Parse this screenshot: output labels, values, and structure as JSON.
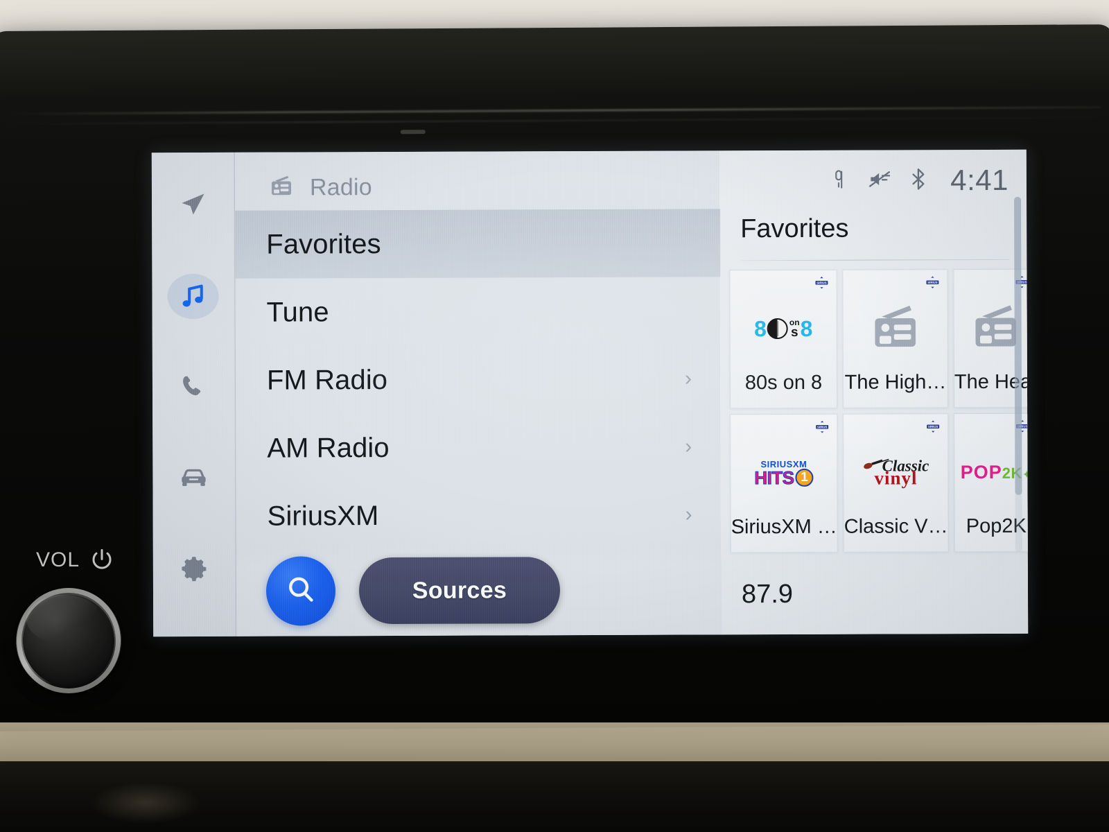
{
  "hardware": {
    "vol_label": "VOL",
    "power_icon": "power-icon",
    "knob_name": "volume-knob"
  },
  "statusbar": {
    "icons": [
      "mic-mute-icon",
      "sound-mute-icon",
      "bluetooth-icon"
    ],
    "time": "4:41"
  },
  "sidebar": {
    "items": [
      {
        "icon": "navigation-arrow-icon",
        "name": "navigation",
        "active": false
      },
      {
        "icon": "music-note-icon",
        "name": "audio",
        "active": true
      },
      {
        "icon": "phone-icon",
        "name": "phone",
        "active": false
      },
      {
        "icon": "car-icon",
        "name": "vehicle",
        "active": false
      },
      {
        "icon": "gear-icon",
        "name": "settings",
        "active": false
      }
    ]
  },
  "list_panel": {
    "header": {
      "icon": "radio-icon",
      "label": "Radio"
    },
    "menu": [
      {
        "label": "Favorites",
        "selected": true,
        "chevron": ""
      },
      {
        "label": "Tune",
        "selected": false,
        "chevron": ""
      },
      {
        "label": "FM Radio",
        "selected": false,
        "chevron": "›"
      },
      {
        "label": "AM Radio",
        "selected": false,
        "chevron": "›"
      },
      {
        "label": "SiriusXM",
        "selected": false,
        "chevron": "›"
      }
    ],
    "search_icon": "search-icon",
    "sources_label": "Sources"
  },
  "favorites": {
    "title": "Favorites",
    "tiles": [
      {
        "label": "80s on 8",
        "logo": "80s-on-8-logo",
        "badge": "siriusxm-badge"
      },
      {
        "label": "The High…",
        "logo": "generic-radio-icon",
        "badge": "siriusxm-badge"
      },
      {
        "label": "The Heat",
        "logo": "generic-radio-icon",
        "badge": "siriusxm-badge"
      },
      {
        "label": "SiriusXM …",
        "logo": "siriusxm-hits1-logo",
        "badge": "siriusxm-badge"
      },
      {
        "label": "Classic V…",
        "logo": "classic-vinyl-logo",
        "badge": "siriusxm-badge"
      },
      {
        "label": "Pop2K",
        "logo": "pop2k-logo",
        "badge": "siriusxm-badge"
      }
    ],
    "frequency": "87.9"
  },
  "colors": {
    "accent_blue": "#1b62f2",
    "sources_pill": "#454a68",
    "screen_bg": "#dfe4e9",
    "text_primary": "#15181c",
    "text_muted": "#8a93a0"
  }
}
